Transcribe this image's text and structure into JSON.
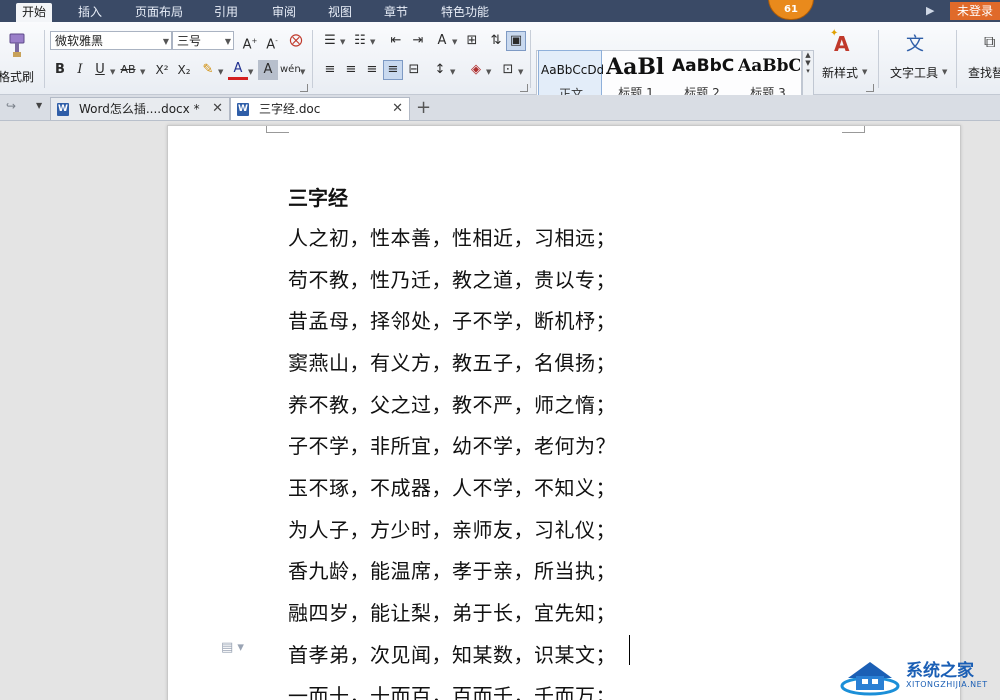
{
  "menu": {
    "tabs": [
      "开始",
      "插入",
      "页面布局",
      "引用",
      "审阅",
      "视图",
      "章节",
      "特色功能"
    ],
    "badge": "61",
    "login": "未登录"
  },
  "ribbon": {
    "format_painter": "格式刷",
    "font_name": "微软雅黑",
    "font_size": "三号",
    "styles": [
      {
        "sample": "AaBbCcDd",
        "name": "正文"
      },
      {
        "sample": "AaBl",
        "name": "标题 1"
      },
      {
        "sample": "AaBbC",
        "name": "标题 2"
      },
      {
        "sample": "AaBbC",
        "name": "标题 3"
      }
    ],
    "new_style": "新样式",
    "text_tools": "文字工具",
    "find_replace": "查找替"
  },
  "tabs": [
    {
      "label": "Word怎么插....docx *"
    },
    {
      "label": "三字经.doc"
    }
  ],
  "document": {
    "title": "三字经",
    "lines": [
      "人之初，性本善，性相近，习相远；",
      "苟不教，性乃迁，教之道，贵以专；",
      "昔孟母，择邻处，子不学，断机杼；",
      "窦燕山，有义方，教五子，名俱扬；",
      "养不教，父之过，教不严，师之惰；",
      "子不学，非所宜，幼不学，老何为？",
      "玉不琢，不成器，人不学，不知义；",
      "为人子，方少时，亲师友，习礼仪；",
      "香九龄，能温席，孝于亲，所当执；",
      "融四岁，能让梨，弟于长，宜先知；",
      "首孝弟，次见闻，知某数，识某文；",
      "一而十，十而百，百而千，千而万；"
    ]
  },
  "watermark": {
    "title": "系统之家",
    "url": "XITONGZHIJIA.NET"
  },
  "colors": {
    "menubar": "#3a4a66",
    "login": "#e06a2a",
    "badge": "#e98a1c"
  }
}
